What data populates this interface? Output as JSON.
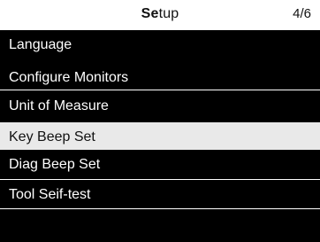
{
  "header": {
    "title_bold": "Se",
    "title_rest": "tup",
    "page_indicator": "4/6"
  },
  "menu": {
    "items": [
      {
        "label": "Language",
        "selected": false
      },
      {
        "label": "Configure Monitors",
        "selected": false
      },
      {
        "label": "Unit of Measure",
        "selected": false
      },
      {
        "label": "Key Beep Set",
        "selected": true
      },
      {
        "label": "Diag Beep Set",
        "selected": false
      },
      {
        "label": "Tool Seif-test",
        "selected": false
      }
    ]
  },
  "colors": {
    "menu_background": "#000000",
    "menu_text": "#ffffff",
    "selected_background": "#e9e9e9",
    "selected_text": "#111111",
    "title_background": "#ffffff",
    "title_text": "#111111",
    "divider": "#ffffff"
  }
}
